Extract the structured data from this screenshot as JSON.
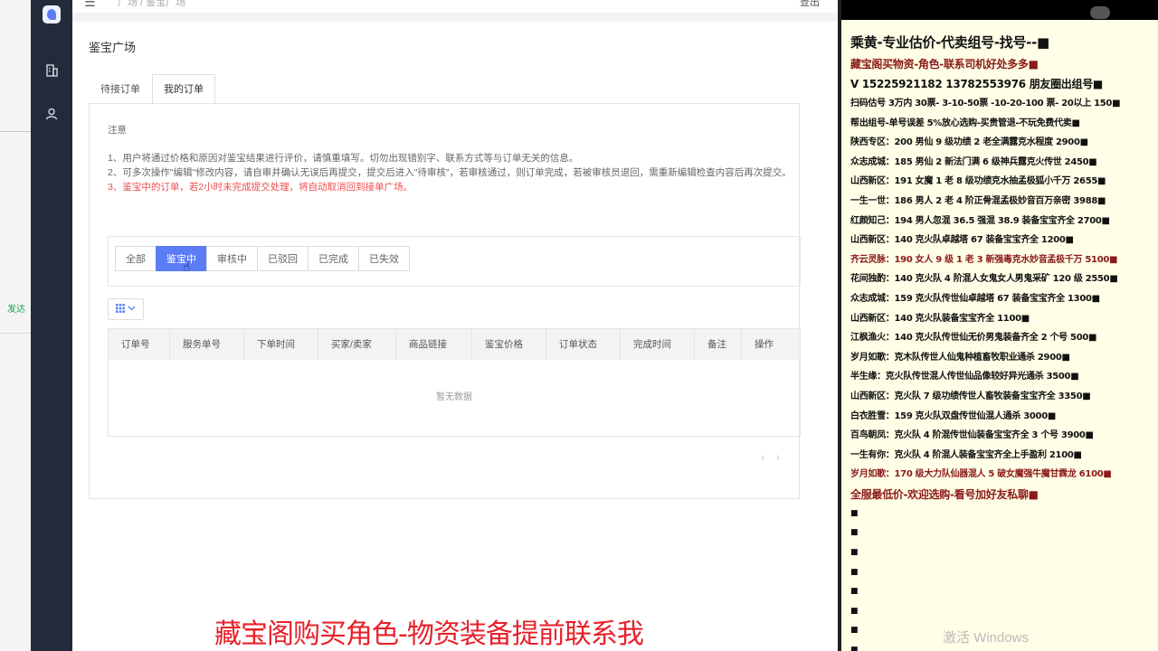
{
  "left_strip": {
    "fragment_text": "发达"
  },
  "topbar": {
    "crumb": "广场 / 鉴宝广场",
    "logout_label": "登出"
  },
  "page": {
    "title": "鉴宝广场"
  },
  "tabs": [
    {
      "label": "待接订单",
      "active": false
    },
    {
      "label": "我的订单",
      "active": true
    }
  ],
  "notice": {
    "title": "注意",
    "line1": "1、用户将通过价格和原因对鉴宝结果进行评价，请慎重填写。切勿出现错别字、联系方式等与订单无关的信息。",
    "line2": "2、可多次操作\"编辑\"修改内容，请自审并确认无误后再提交，提交后进入\"待审核\"，若审核通过，则订单完成，若被审核员退回，需重新编辑检查内容后再次提交。",
    "line3": "3、鉴宝中的订单，若2小时未完成提交处理，将自动取消回到接单广场。"
  },
  "filters": [
    {
      "label": "全部",
      "active": false
    },
    {
      "label": "鉴宝中",
      "active": true
    },
    {
      "label": "审核中",
      "active": false
    },
    {
      "label": "已驳回",
      "active": false
    },
    {
      "label": "已完成",
      "active": false
    },
    {
      "label": "已失效",
      "active": false
    }
  ],
  "column_button": {
    "grid_icon": "grid-icon",
    "chevron_icon": "chevron-down-icon"
  },
  "table": {
    "headers": [
      "订单号",
      "服务单号",
      "下单时间",
      "买家/卖家",
      "商品链接",
      "鉴宝价格",
      "订单状态",
      "完成时间",
      "备注",
      "操作"
    ],
    "empty_text": "暂无数据"
  },
  "right_panel": {
    "lines": [
      {
        "text": "乘黄-专业估价-代卖组号-找号--■",
        "style": "big"
      },
      {
        "text": "藏宝阁买物资-角色-联系司机好处多多■",
        "style": "mid dark-red"
      },
      {
        "text": "V 15225921182    13782553976 朋友圈出组号■",
        "style": "mid"
      },
      {
        "text": "扫码估号 3万内 30票- 3-10-50票  -10-20-100 票- 20以上 150■",
        "style": ""
      },
      {
        "text": "帮出组号-单号误差 5%放心选购-买贵管退-不玩免费代卖■",
        "style": ""
      },
      {
        "text": "陕西专区：200 男仙 9 级功绩 2 老全满露克水程度 2900■",
        "style": ""
      },
      {
        "text": "众志成城：185 男仙 2 新法门满 6 级神兵露克火传世 2450■",
        "style": ""
      },
      {
        "text": "山西新区：191 女魔 1 老 8 级功绩克水抽孟极狐小千万 2655■",
        "style": ""
      },
      {
        "text": "一生一世：186 男人 2 老 4 阶正骨混孟极妙音百万亲密 3988■",
        "style": ""
      },
      {
        "text": "红颜知己：194 男人忽混 36.5 强混 38.9 装备宝宝齐全 2700■",
        "style": ""
      },
      {
        "text": "山西新区：140 克火队卓越塔 67 装备宝宝齐全 1200■",
        "style": ""
      },
      {
        "text": "齐云灵脉：190 女人 9 级 1 老 3 新强毒克水妙音孟极千万 5100■",
        "style": "dark-red"
      },
      {
        "text": "花间独酌：140 克火队 4 阶混人女鬼女人男鬼采矿 120 级 2550■",
        "style": ""
      },
      {
        "text": "众志成城：159 克火队传世仙卓越塔 67 装备宝宝齐全 1300■",
        "style": ""
      },
      {
        "text": "山西新区：140 克火队装备宝宝齐全 1100■",
        "style": ""
      },
      {
        "text": "江枫渔火：140 克火队传世仙无价男鬼装备齐全 2 个号 500■",
        "style": ""
      },
      {
        "text": "岁月如歌：克木队传世人仙鬼种植畜牧职业通杀 2900■",
        "style": ""
      },
      {
        "text": "半生缘：克火队传世混人传世仙品像较好异光通杀 3500■",
        "style": ""
      },
      {
        "text": "山西新区：克火队 7 级功绩传世人畜牧装备宝宝齐全 3350■",
        "style": ""
      },
      {
        "text": "白衣胜雪：159 克火队双盘传世仙混人通杀 3000■",
        "style": ""
      },
      {
        "text": "百鸟朝凤：克火队 4 阶混传世仙装备宝宝齐全 3 个号 3900■",
        "style": ""
      },
      {
        "text": "一生有你：克火队 4 阶混人装备宝宝齐全上手盈利 2100■",
        "style": ""
      },
      {
        "text": "岁月如歌：170 级大力队仙器混人 5 破女魔强牛魔甘霖龙 6100■",
        "style": "dark-red"
      },
      {
        "text": "全服最低价-欢迎选购-看号加好友私聊■",
        "style": "mid dark-red"
      },
      {
        "text": "■",
        "style": "sq"
      },
      {
        "text": "■",
        "style": "sq"
      },
      {
        "text": "■",
        "style": "sq"
      },
      {
        "text": "■",
        "style": "sq"
      },
      {
        "text": "■",
        "style": "sq"
      },
      {
        "text": "■",
        "style": "sq"
      },
      {
        "text": "■",
        "style": "sq"
      },
      {
        "text": "■",
        "style": "sq"
      }
    ],
    "watermark": "激活 Windows"
  },
  "overlay_caption": "藏宝阁购买角色-物资装备提前联系我",
  "colors": {
    "accent": "#5b7cf5",
    "sidebar": "#232b3a",
    "caption_red": "#e8202a",
    "notice_red": "#ee4d4d",
    "panel_bg": "#fffee6"
  }
}
